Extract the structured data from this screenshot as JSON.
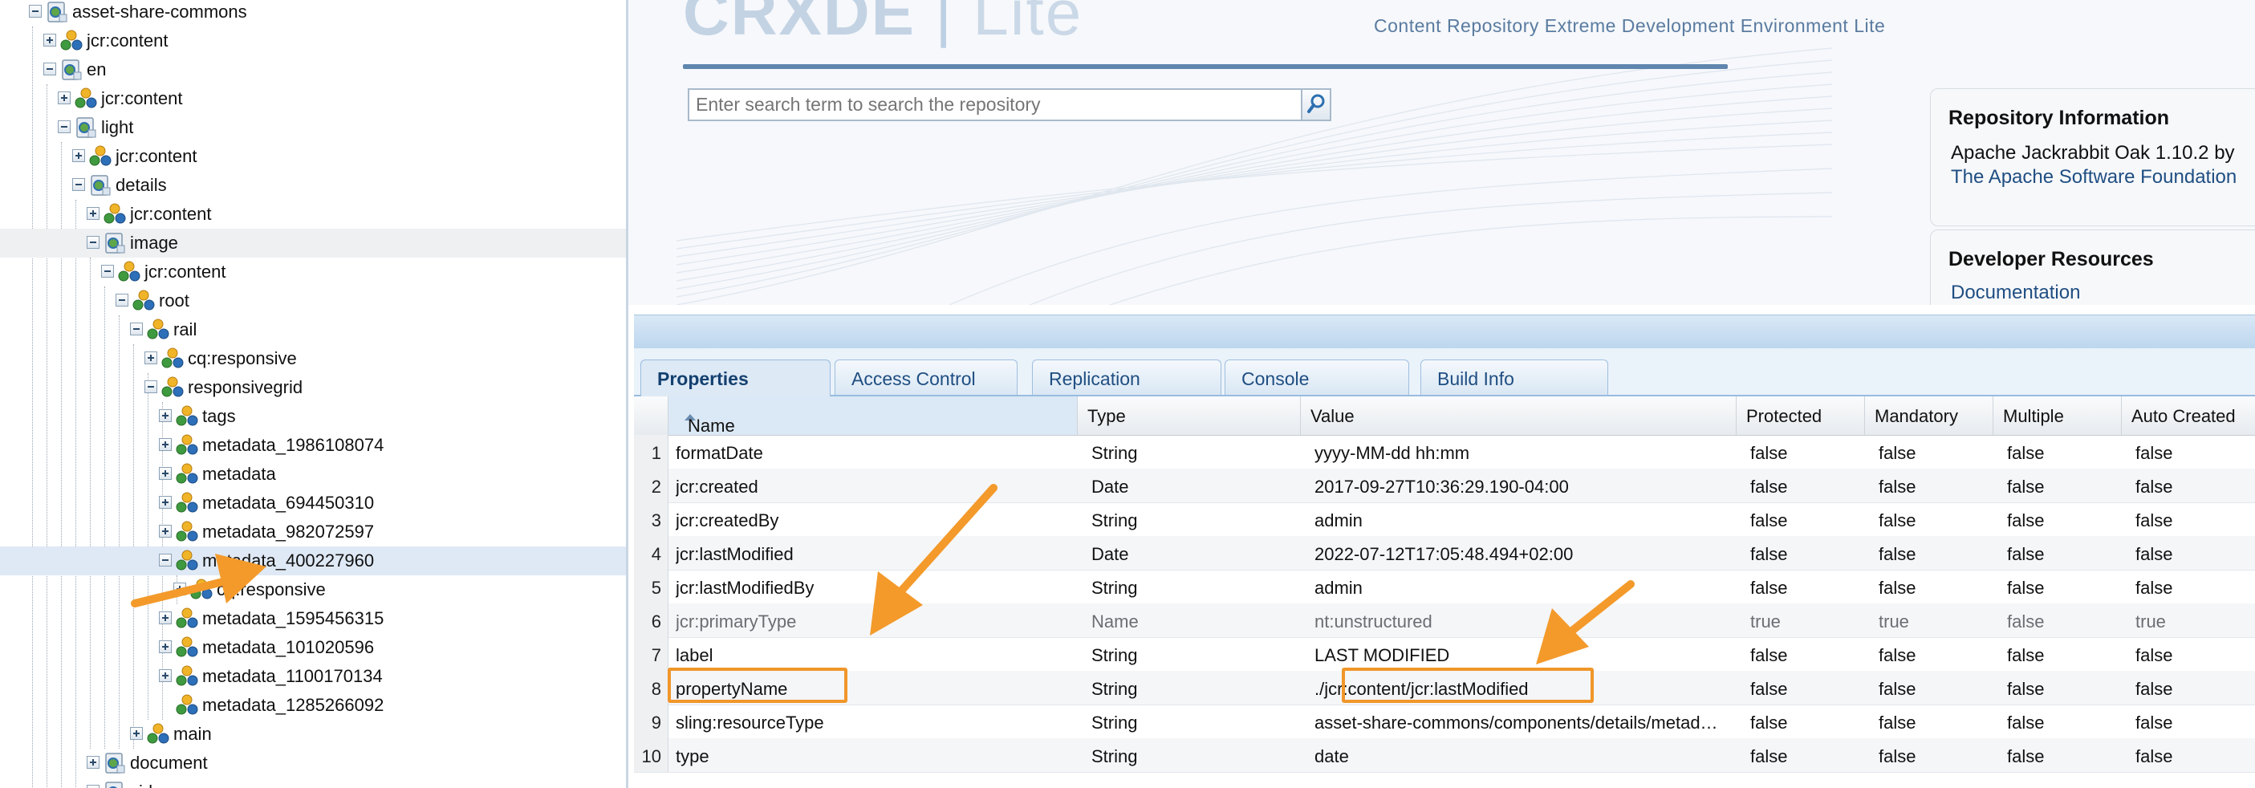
{
  "tree": {
    "nodes": [
      {
        "label": "asset-share-commons",
        "icon": "folder-page-icon",
        "expander": "minus"
      },
      {
        "label": "jcr:content",
        "icon": "node-icon",
        "expander": "plus"
      },
      {
        "label": "en",
        "icon": "folder-page-icon",
        "expander": "minus"
      },
      {
        "label": "jcr:content",
        "icon": "node-icon",
        "expander": "plus"
      },
      {
        "label": "light",
        "icon": "folder-page-icon",
        "expander": "minus"
      },
      {
        "label": "jcr:content",
        "icon": "node-icon",
        "expander": "plus"
      },
      {
        "label": "details",
        "icon": "folder-page-icon",
        "expander": "minus"
      },
      {
        "label": "jcr:content",
        "icon": "node-icon",
        "expander": "plus"
      },
      {
        "label": "image",
        "icon": "folder-page-icon",
        "expander": "minus"
      },
      {
        "label": "jcr:content",
        "icon": "node-icon",
        "expander": "minus"
      },
      {
        "label": "root",
        "icon": "node-icon",
        "expander": "minus"
      },
      {
        "label": "rail",
        "icon": "node-icon",
        "expander": "minus"
      },
      {
        "label": "cq:responsive",
        "icon": "node-icon",
        "expander": "plus"
      },
      {
        "label": "responsivegrid",
        "icon": "node-icon",
        "expander": "minus"
      },
      {
        "label": "tags",
        "icon": "node-icon",
        "expander": "plus"
      },
      {
        "label": "metadata_1986108074",
        "icon": "node-icon",
        "expander": "plus"
      },
      {
        "label": "metadata",
        "icon": "node-icon",
        "expander": "plus"
      },
      {
        "label": "metadata_694450310",
        "icon": "node-icon",
        "expander": "plus"
      },
      {
        "label": "metadata_982072597",
        "icon": "node-icon",
        "expander": "plus"
      },
      {
        "label": "metadata_400227960",
        "icon": "node-icon",
        "expander": "minus"
      },
      {
        "label": "cq:responsive",
        "icon": "node-icon",
        "expander": "plus"
      },
      {
        "label": "metadata_1595456315",
        "icon": "node-icon",
        "expander": "plus"
      },
      {
        "label": "metadata_101020596",
        "icon": "node-icon",
        "expander": "plus"
      },
      {
        "label": "metadata_1100170134",
        "icon": "node-icon",
        "expander": "plus"
      },
      {
        "label": "metadata_1285266092",
        "icon": "node-icon",
        "expander": "none"
      },
      {
        "label": "main",
        "icon": "node-icon",
        "expander": "plus"
      },
      {
        "label": "document",
        "icon": "folder-page-icon",
        "expander": "plus"
      },
      {
        "label": "vid...",
        "icon": "folder-page-icon",
        "expander": "plus"
      }
    ]
  },
  "header": {
    "logo_main": "CRXDE",
    "logo_lite": "Lite",
    "tagline": "Content Repository Extreme Development Environment Lite"
  },
  "search": {
    "placeholder": "Enter search term to search the repository"
  },
  "repo_info": {
    "title": "Repository Information",
    "line1": "Apache Jackrabbit Oak 1.10.2 by",
    "link": "The Apache Software Foundation"
  },
  "dev_resources": {
    "title": "Developer Resources",
    "link": "Documentation"
  },
  "tabs": [
    {
      "label": "Properties",
      "active": true
    },
    {
      "label": "Access Control",
      "active": false
    },
    {
      "label": "Replication",
      "active": false
    },
    {
      "label": "Console",
      "active": false
    },
    {
      "label": "Build Info",
      "active": false
    }
  ],
  "properties": {
    "columns": [
      "Name",
      "Type",
      "Value",
      "Protected",
      "Mandatory",
      "Multiple",
      "Auto Created"
    ],
    "sort_column": "Name",
    "rows": [
      {
        "num": "1",
        "name": "formatDate",
        "type": "String",
        "value": "yyyy-MM-dd hh:mm",
        "protected": "false",
        "mandatory": "false",
        "multiple": "false",
        "auto_created": "false"
      },
      {
        "num": "2",
        "name": "jcr:created",
        "type": "Date",
        "value": "2017-09-27T10:36:29.190-04:00",
        "protected": "false",
        "mandatory": "false",
        "multiple": "false",
        "auto_created": "false"
      },
      {
        "num": "3",
        "name": "jcr:createdBy",
        "type": "String",
        "value": "admin",
        "protected": "false",
        "mandatory": "false",
        "multiple": "false",
        "auto_created": "false"
      },
      {
        "num": "4",
        "name": "jcr:lastModified",
        "type": "Date",
        "value": "2022-07-12T17:05:48.494+02:00",
        "protected": "false",
        "mandatory": "false",
        "multiple": "false",
        "auto_created": "false"
      },
      {
        "num": "5",
        "name": "jcr:lastModifiedBy",
        "type": "String",
        "value": "admin",
        "protected": "false",
        "mandatory": "false",
        "multiple": "false",
        "auto_created": "false"
      },
      {
        "num": "6",
        "name": "jcr:primaryType",
        "type": "Name",
        "value": "nt:unstructured",
        "protected": "true",
        "mandatory": "true",
        "multiple": "false",
        "auto_created": "true"
      },
      {
        "num": "7",
        "name": "label",
        "type": "String",
        "value": "LAST MODIFIED",
        "protected": "false",
        "mandatory": "false",
        "multiple": "false",
        "auto_created": "false"
      },
      {
        "num": "8",
        "name": "propertyName",
        "type": "String",
        "value": "./jcr:content/jcr:lastModified",
        "protected": "false",
        "mandatory": "false",
        "multiple": "false",
        "auto_created": "false"
      },
      {
        "num": "9",
        "name": "sling:resourceType",
        "type": "String",
        "value": "asset-share-commons/components/details/metad…",
        "protected": "false",
        "mandatory": "false",
        "multiple": "false",
        "auto_created": "false"
      },
      {
        "num": "10",
        "name": "type",
        "type": "String",
        "value": "date",
        "protected": "false",
        "mandatory": "false",
        "multiple": "false",
        "auto_created": "false"
      }
    ]
  },
  "colors": {
    "annotation_orange": "#f0962a",
    "link_blue": "#1f4e82",
    "selected_row": "#dfe9f5"
  }
}
